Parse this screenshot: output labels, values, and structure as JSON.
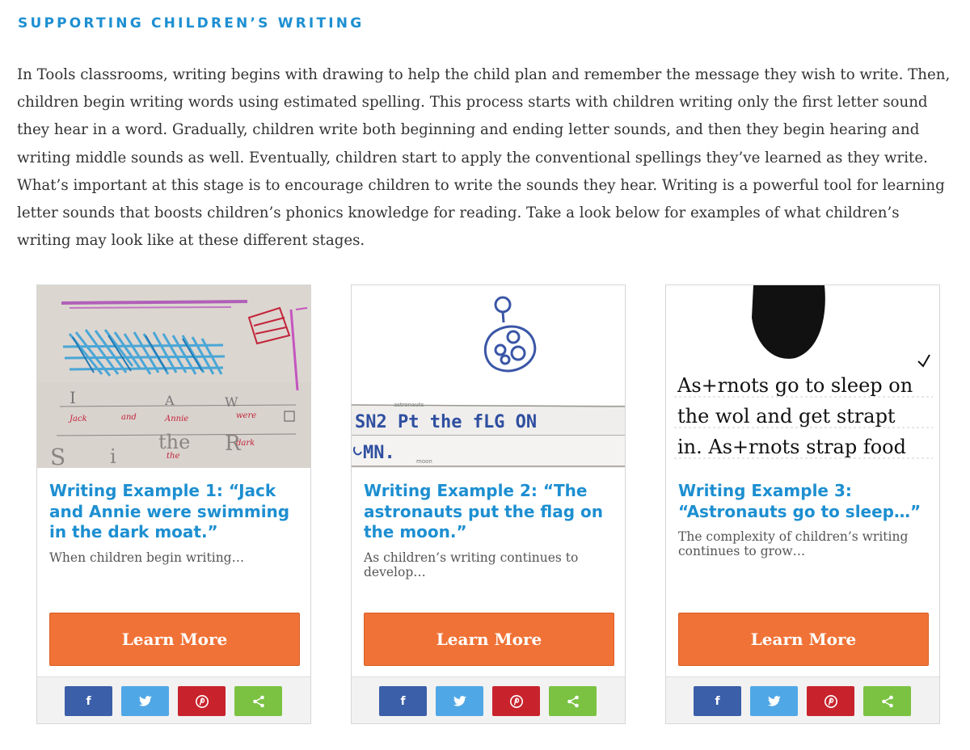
{
  "section": {
    "title": "SUPPORTING CHILDREN’S WRITING",
    "intro": "In Tools classrooms, writing begins with drawing to help the child plan and remember the message they wish to write. Then, children begin writing words using estimated spelling. This process starts with children writing only the first letter sound they hear in a word. Gradually, children write both beginning and ending letter sounds, and then they begin hearing and writing middle sounds as well. Eventually, children start to apply the conventional spellings they’ve learned as they write. What’s important at this stage is to encourage children to write the sounds they hear. Writing is a powerful tool for learning letter sounds that boosts children’s phonics knowledge for reading. Take a look below for examples of what children’s writing may look like at these different stages."
  },
  "cards": [
    {
      "title": "Writing Example 1: “Jack and Annie were swimming in the dark moat.”",
      "description": "When children begin writing…",
      "button_label": "Learn More",
      "image_text": {
        "letters": [
          "I",
          "A",
          "W"
        ],
        "words": [
          "Jack",
          "and",
          "Annie",
          "were",
          "dark"
        ],
        "scribble": [
          "S",
          "i",
          "the",
          "R"
        ],
        "small": "the"
      }
    },
    {
      "title": "Writing Example 2: “The astronauts put the flag on the moon.”",
      "description": "As children’s writing continues to develop…",
      "button_label": "Learn More",
      "image_text": {
        "line1": "SN2 Pt the fLG ON",
        "line2": "MN.",
        "caption1": "astronauts",
        "caption2": "moon"
      }
    },
    {
      "title": "Writing Example 3: “Astronauts go to sleep…”",
      "description": "The complexity of children’s writing continues to grow…",
      "button_label": "Learn More",
      "image_text": {
        "line1": "As+rnots go to sleep on",
        "line2": "the wol and get strapt",
        "line3": "in. As+rnots strap food"
      }
    }
  ],
  "share": {
    "facebook_icon": "f",
    "twitter_icon": "twitter-bird",
    "pinterest_icon": "pinterest-p",
    "share_icon": "share-nodes"
  },
  "colors": {
    "accent_blue": "#1d8fd1",
    "button_orange": "#f07236",
    "facebook": "#3b5fa8",
    "twitter": "#50a7e6",
    "pinterest": "#c8232c",
    "share": "#7bc243"
  }
}
